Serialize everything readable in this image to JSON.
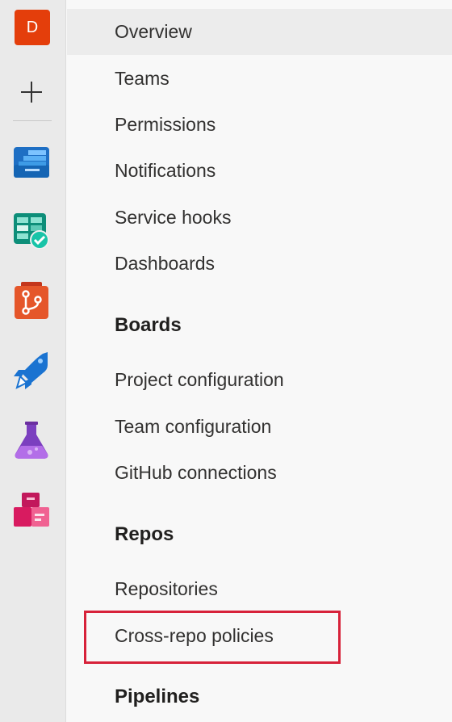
{
  "rail": {
    "org_initial": "D",
    "items": [
      {
        "name": "new-project-icon"
      },
      {
        "name": "boards-overview-icon"
      },
      {
        "name": "boards-icon"
      },
      {
        "name": "repos-icon"
      },
      {
        "name": "pipelines-icon"
      },
      {
        "name": "test-plans-icon"
      },
      {
        "name": "artifacts-icon"
      }
    ]
  },
  "nav": {
    "general": [
      {
        "label": "Overview",
        "selected": true
      },
      {
        "label": "Teams"
      },
      {
        "label": "Permissions"
      },
      {
        "label": "Notifications"
      },
      {
        "label": "Service hooks"
      },
      {
        "label": "Dashboards"
      }
    ],
    "boards": {
      "title": "Boards",
      "items": [
        {
          "label": "Project configuration"
        },
        {
          "label": "Team configuration"
        },
        {
          "label": "GitHub connections"
        }
      ]
    },
    "repos": {
      "title": "Repos",
      "items": [
        {
          "label": "Repositories"
        },
        {
          "label": "Cross-repo policies"
        }
      ]
    },
    "pipelines": {
      "title": "Pipelines"
    }
  },
  "colors": {
    "org_badge": "#e43e0b",
    "highlight": "#d7223a",
    "selected_bg": "#ececec",
    "rail_bg": "#eaeaea",
    "panel_bg": "#f8f8f8"
  }
}
